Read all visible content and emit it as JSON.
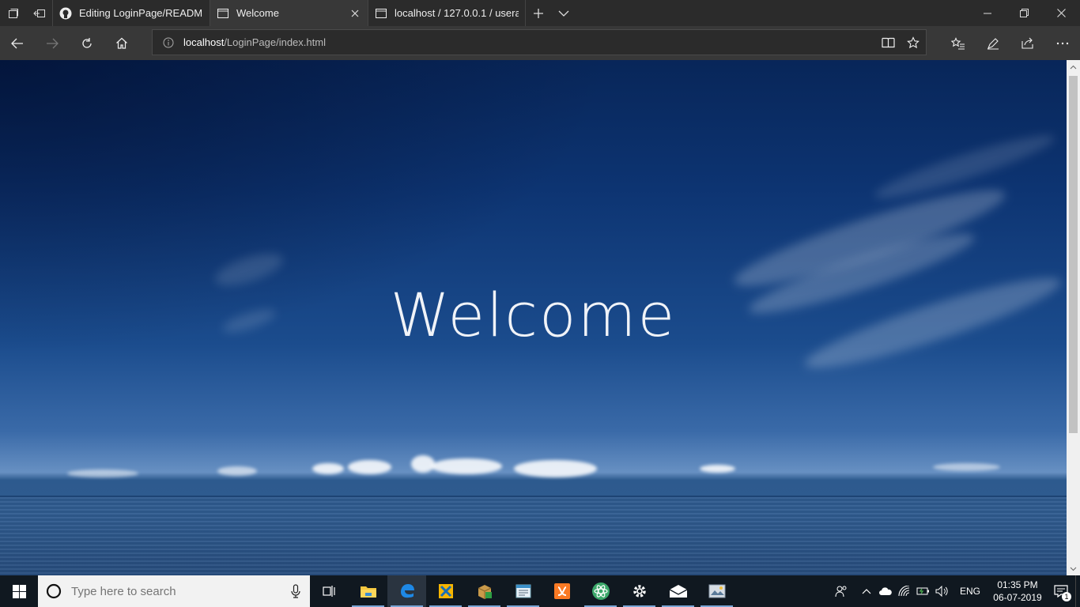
{
  "browser": {
    "tabs": [
      {
        "title": "Editing LoginPage/README",
        "favicon": "github-icon",
        "active": false
      },
      {
        "title": "Welcome",
        "favicon": "page-icon",
        "active": true
      },
      {
        "title": "localhost / 127.0.0.1 / usera",
        "favicon": "page-icon",
        "active": false
      }
    ],
    "address": {
      "host": "localhost",
      "path": "/LoginPage/index.html"
    }
  },
  "page": {
    "heading": "Welcome"
  },
  "taskbar": {
    "search_placeholder": "Type here to search",
    "pinned_apps": [
      "task-view-icon",
      "file-explorer-icon",
      "edge-icon",
      "xampp-control-icon",
      "archive-icon",
      "notepad-icon",
      "xampp-icon",
      "atom-icon",
      "settings-icon",
      "mail-icon",
      "photos-icon"
    ],
    "tray": {
      "language": "ENG",
      "time": "01:35 PM",
      "date": "06-07-2019",
      "notification_count": "1"
    }
  },
  "colors": {
    "chrome_dark": "#2b2b2b",
    "chrome_mid": "#383838",
    "taskbar": "#101820",
    "welcome_text": "#f0f3f8"
  }
}
